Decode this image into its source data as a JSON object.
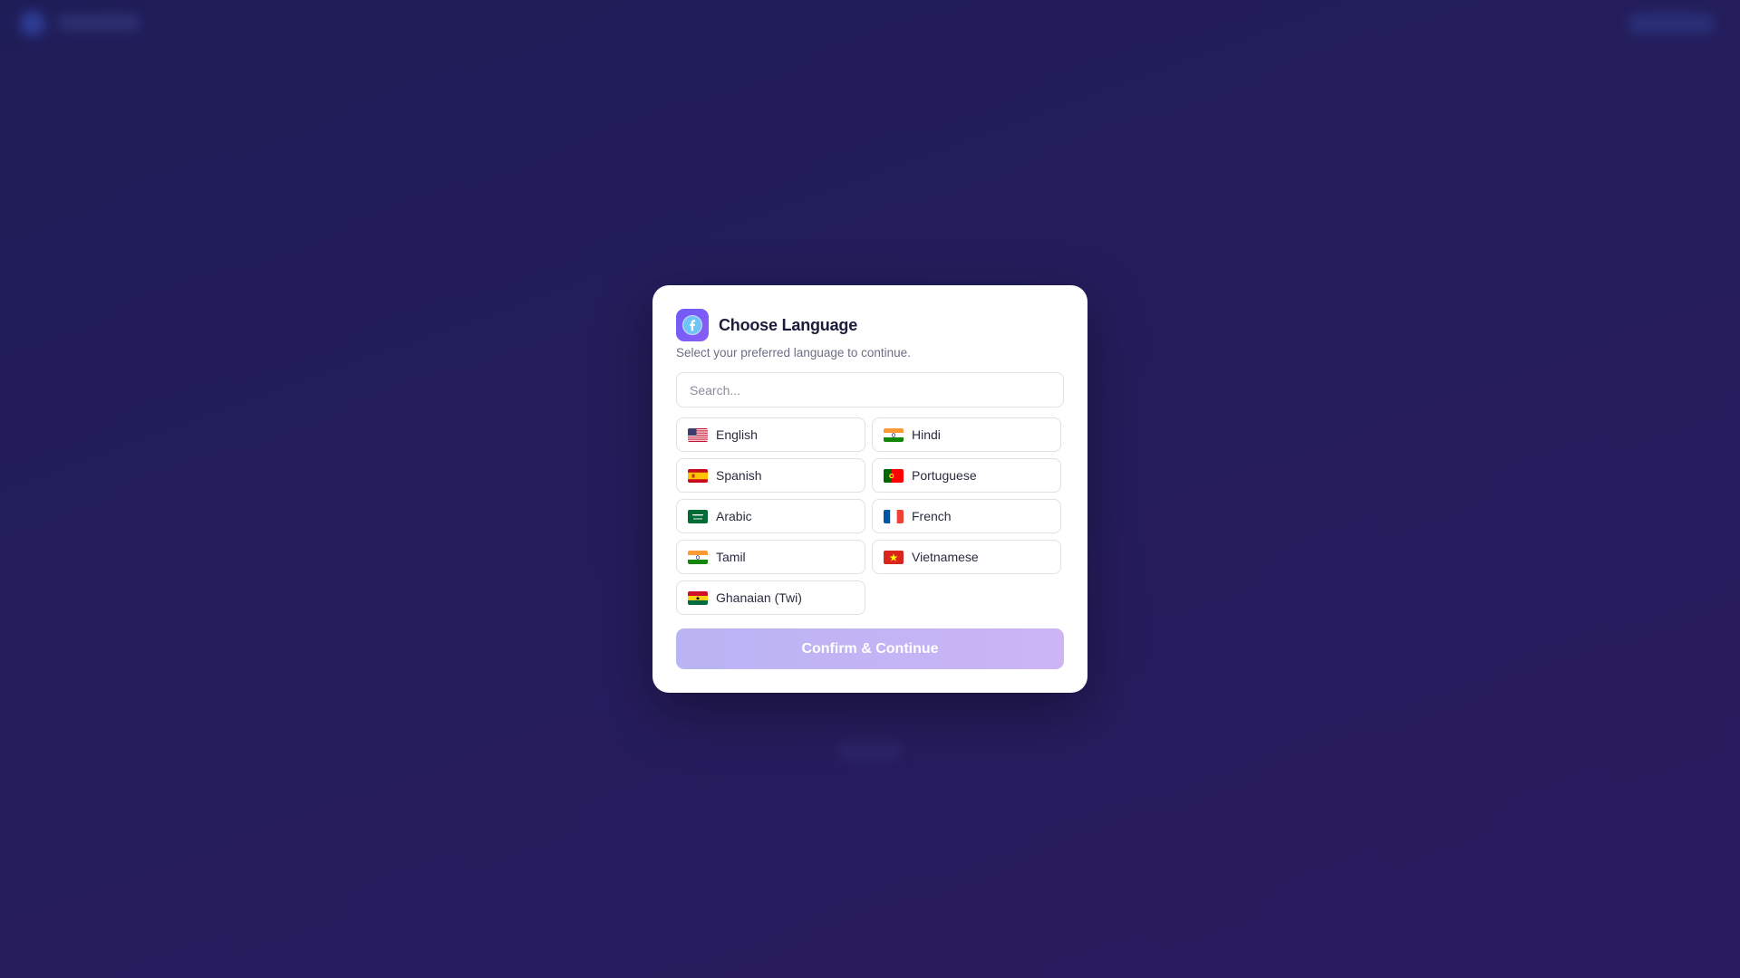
{
  "modal": {
    "title": "Choose Language",
    "subtitle": "Select your preferred language to continue.",
    "search_placeholder": "Search...",
    "confirm_label": "Confirm & Continue",
    "languages": [
      {
        "label": "English",
        "flag": "us-flag-icon"
      },
      {
        "label": "Hindi",
        "flag": "india-flag-icon"
      },
      {
        "label": "Spanish",
        "flag": "spain-flag-icon"
      },
      {
        "label": "Portuguese",
        "flag": "portugal-flag-icon"
      },
      {
        "label": "Arabic",
        "flag": "saudi-arabia-flag-icon"
      },
      {
        "label": "French",
        "flag": "france-flag-icon"
      },
      {
        "label": "Tamil",
        "flag": "india-flag-icon"
      },
      {
        "label": "Vietnamese",
        "flag": "vietnam-flag-icon"
      },
      {
        "label": "Ghanaian (Twi)",
        "flag": "ghana-flag-icon"
      }
    ]
  },
  "colors": {
    "background": "#221d5b",
    "accent": "#7c5cf6",
    "confirm_disabled": "#c1b4f4"
  }
}
